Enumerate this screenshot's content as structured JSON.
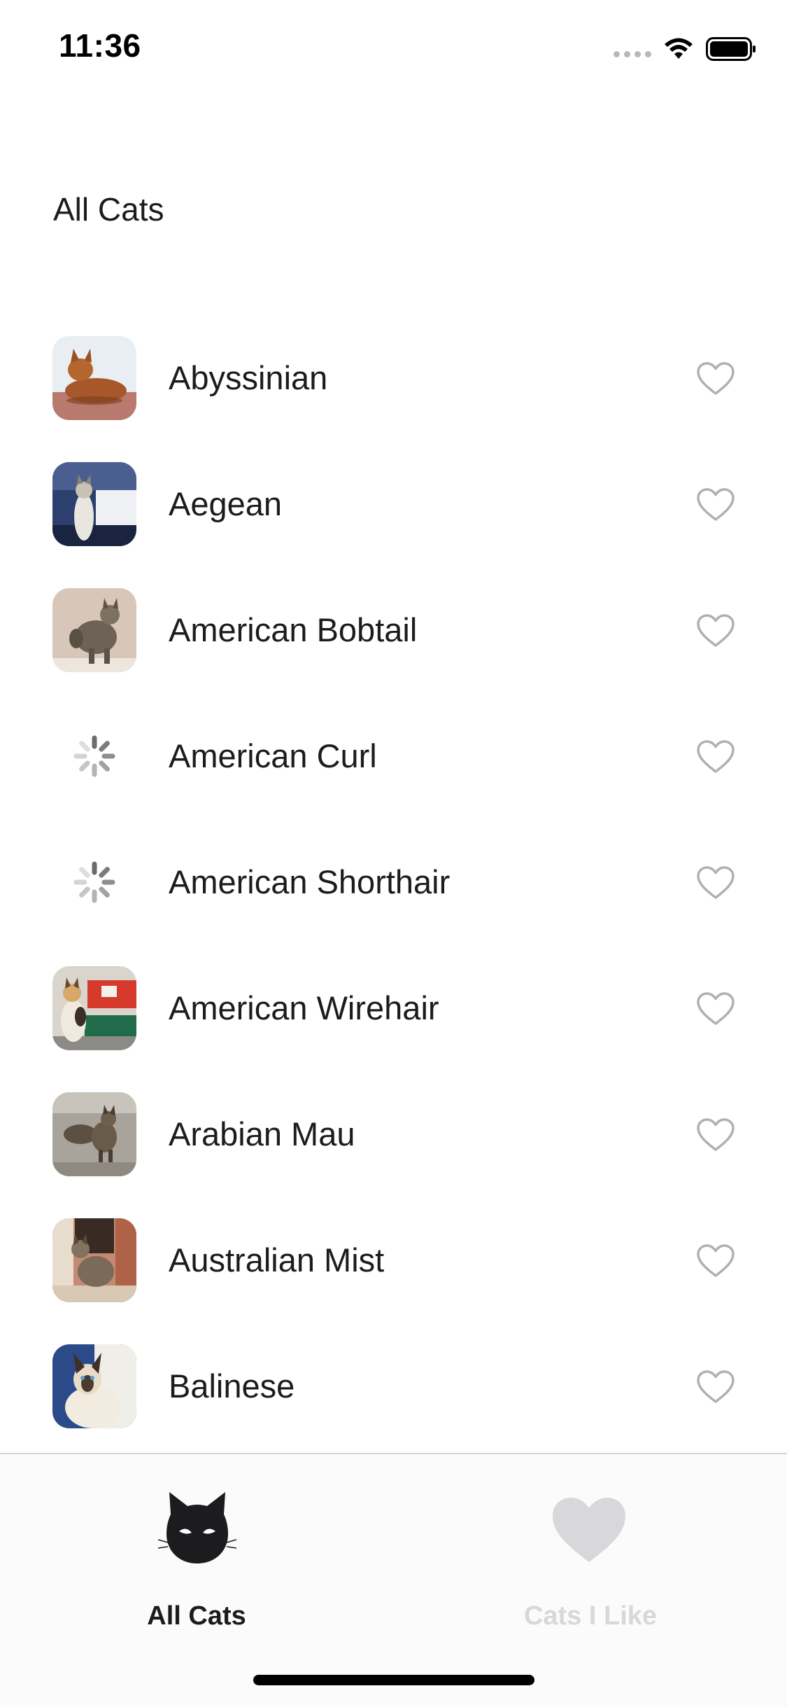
{
  "status_bar": {
    "time": "11:36"
  },
  "page": {
    "title": "All Cats"
  },
  "cats": [
    {
      "name": "Abyssinian",
      "image": "loaded",
      "liked": false
    },
    {
      "name": "Aegean",
      "image": "loaded",
      "liked": false
    },
    {
      "name": "American Bobtail",
      "image": "loaded",
      "liked": false
    },
    {
      "name": "American Curl",
      "image": "loading",
      "liked": false
    },
    {
      "name": "American Shorthair",
      "image": "loading",
      "liked": false
    },
    {
      "name": "American Wirehair",
      "image": "loaded",
      "liked": false
    },
    {
      "name": "Arabian Mau",
      "image": "loaded",
      "liked": false
    },
    {
      "name": "Australian Mist",
      "image": "loaded",
      "liked": false
    },
    {
      "name": "Balinese",
      "image": "loaded",
      "liked": false
    }
  ],
  "tab_bar": {
    "tabs": [
      {
        "label": "All Cats",
        "icon": "cat-face-icon",
        "selected": true
      },
      {
        "label": "Cats I Like",
        "icon": "heart-filled-icon",
        "selected": false
      }
    ]
  },
  "colors": {
    "active_tab": "#1c1c1e",
    "inactive_tab": "#d8d8da",
    "heart_outline": "#b0b0b4"
  }
}
